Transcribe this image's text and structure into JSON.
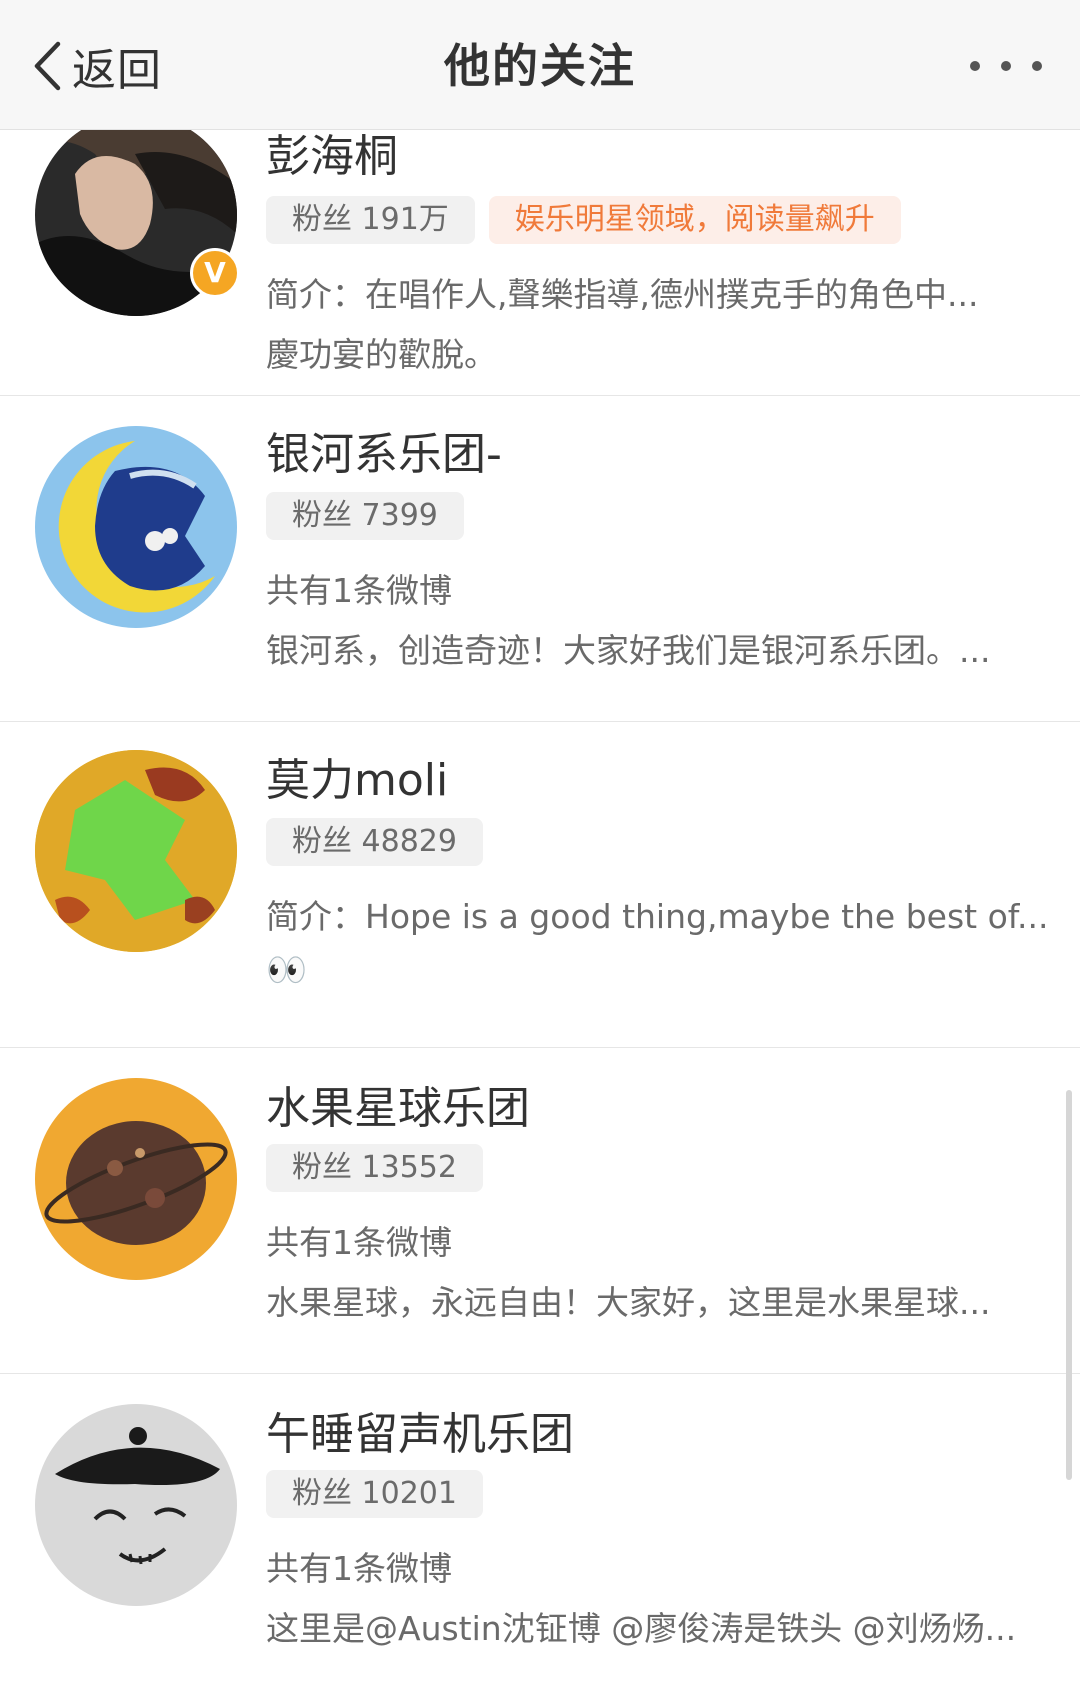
{
  "nav": {
    "back_label": "返回",
    "title": "他的关注"
  },
  "users": [
    {
      "name": "彭海桐",
      "fans": "粉丝 191万",
      "badge": "娱乐明星领域，阅读量飙升",
      "verified": "V",
      "line1": "简介：在唱作人,聲樂指導,德州撲克手的角色中...",
      "line2": "慶功宴的歡脫。"
    },
    {
      "name": "银河系乐团-",
      "fans": "粉丝 7399",
      "line1": "共有1条微博",
      "line2": "银河系，创造奇迹！大家好我们是银河系乐团。..."
    },
    {
      "name": "莫力moli",
      "fans": "粉丝 48829",
      "line1": "简介：Hope is a good thing,maybe the best of...",
      "line2": "👀"
    },
    {
      "name": "水果星球乐团",
      "fans": "粉丝 13552",
      "line1": "共有1条微博",
      "line2": "水果星球，永远自由！大家好，这里是水果星球..."
    },
    {
      "name": "午睡留声机乐团",
      "fans": "粉丝 10201",
      "line1": "共有1条微博",
      "line2": "这里是@Austin沈钲博 @廖俊涛是铁头 @刘炀炀..."
    }
  ],
  "colors": {
    "nav_bg": "#f7f7f7",
    "badge_bg": "#fdeee8",
    "badge_text": "#f07a3a",
    "verified": "#f5a623"
  },
  "icons": {
    "back": "chevron-left-icon",
    "more": "more-dots-icon",
    "verified": "verified-badge-icon"
  }
}
